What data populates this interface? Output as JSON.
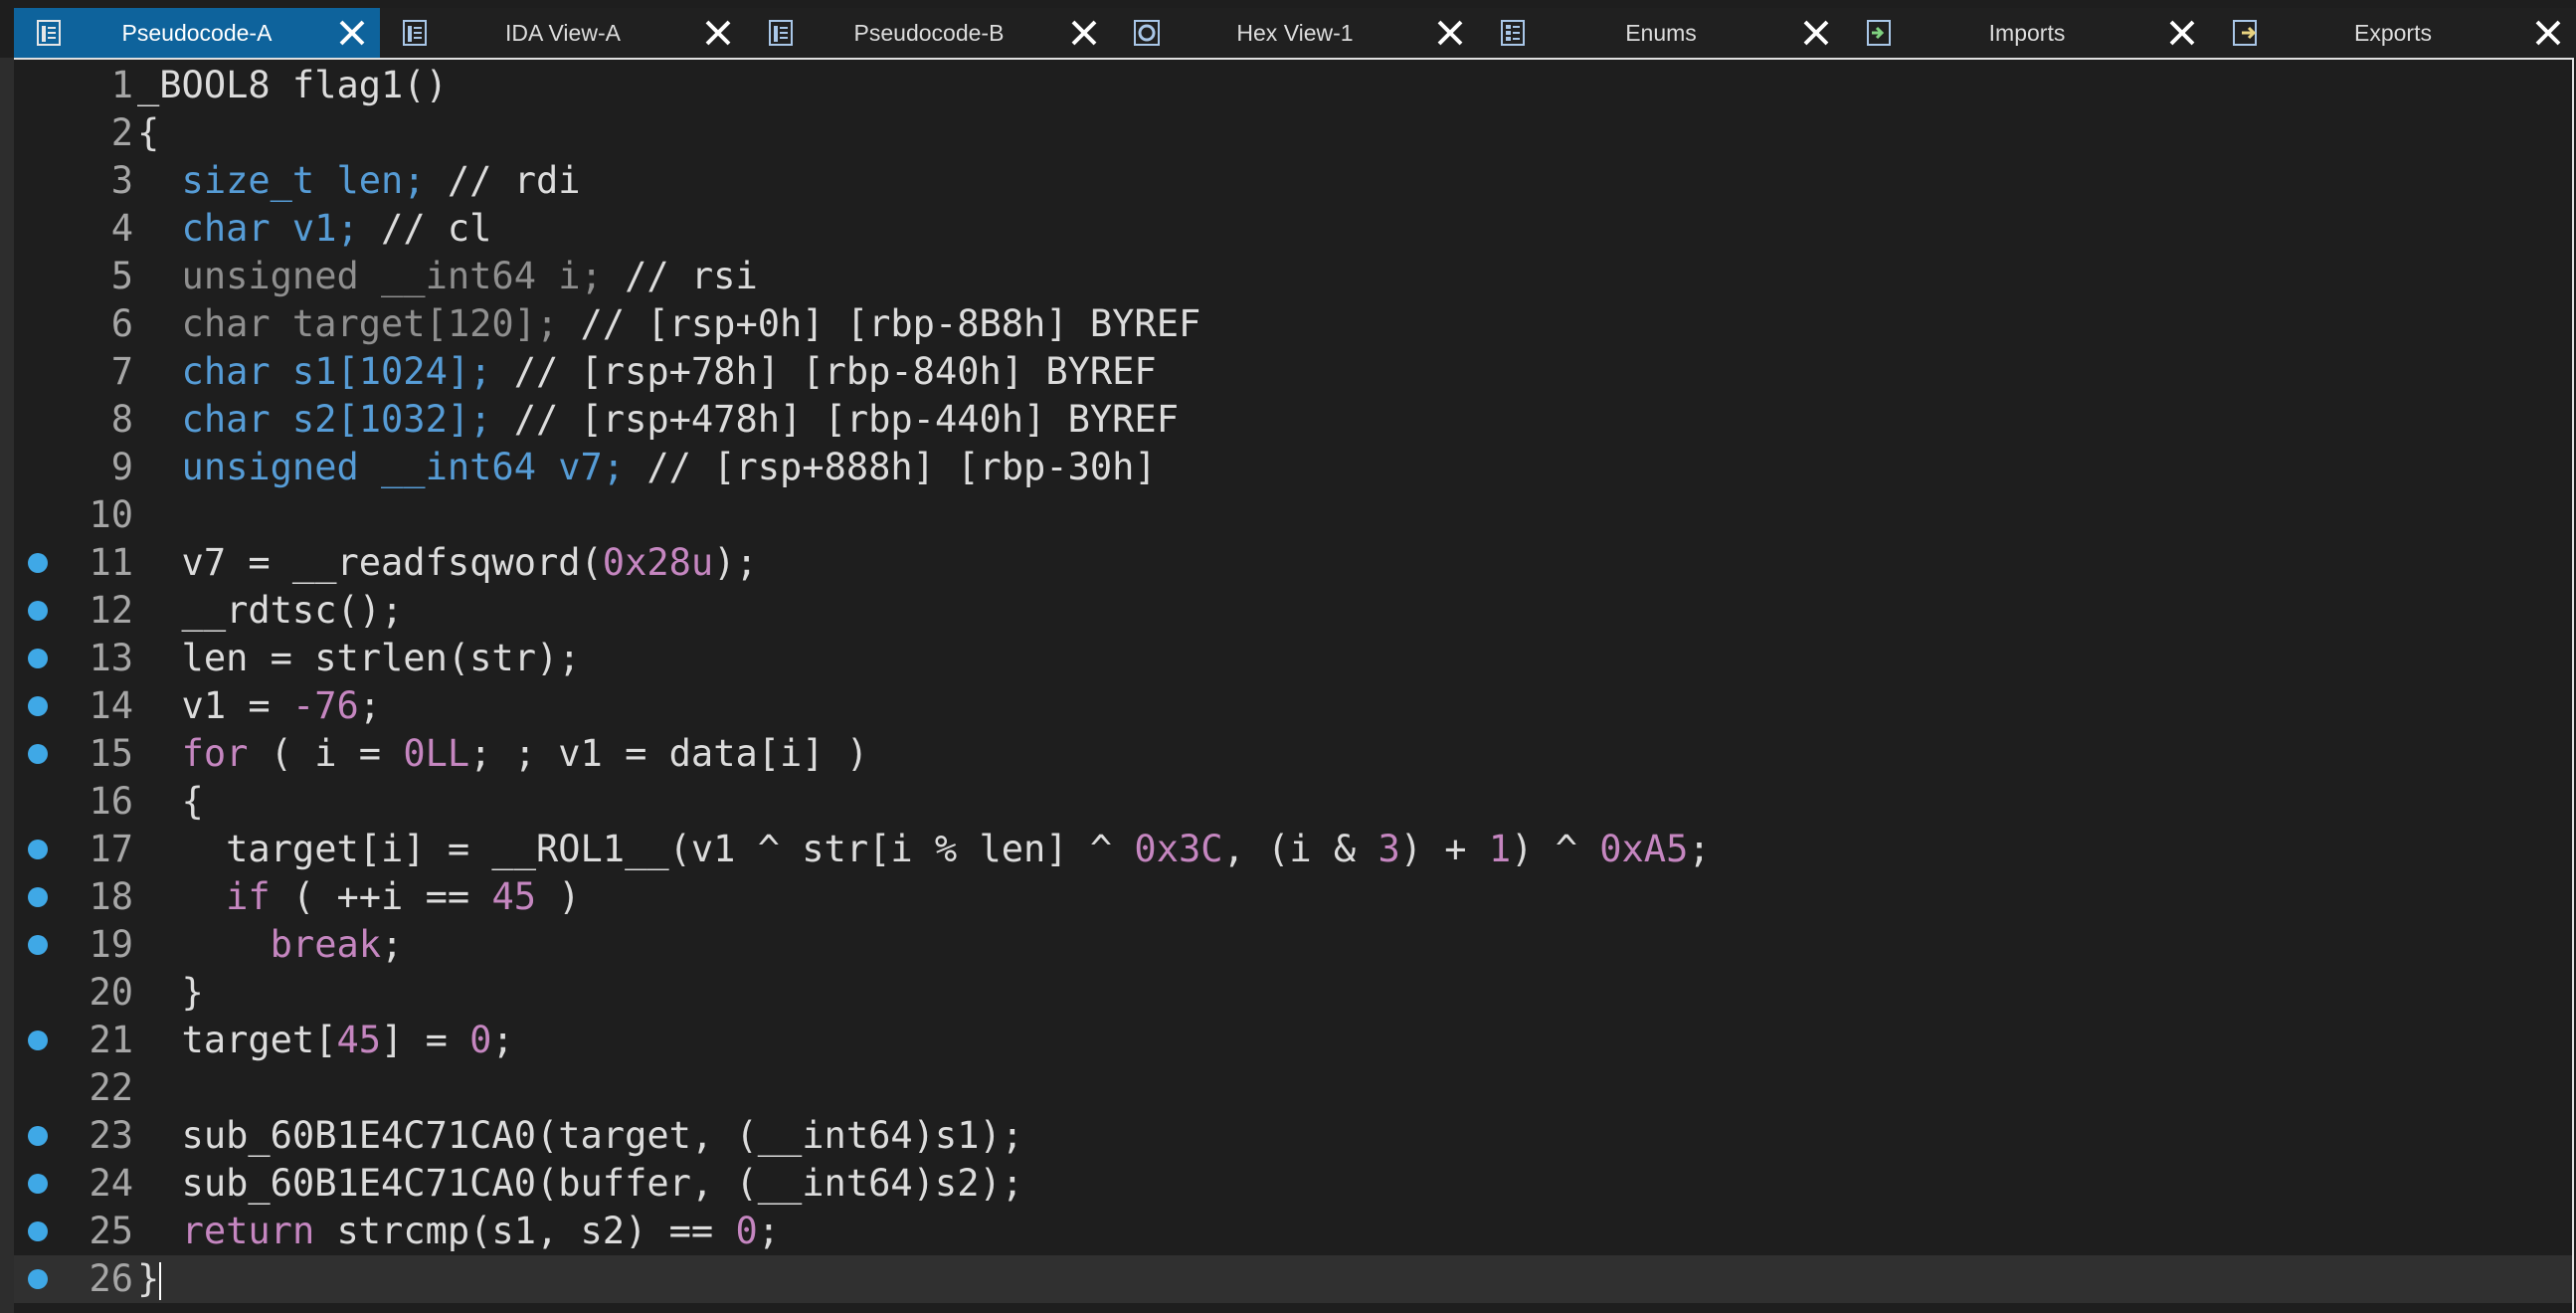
{
  "colors": {
    "active_tab": "#0e639c",
    "tabbar_bg": "#202020",
    "editor_bg": "#1e1e1e",
    "current_line": "#303030",
    "breakpoint_dot": "#3fa8e6",
    "keyword": "#569cd6",
    "number": "#b5cea8",
    "control": "#c586c0"
  },
  "tabs": [
    {
      "label": "Pseudocode-A",
      "icon": "pseudocode-icon",
      "active": true
    },
    {
      "label": "IDA View-A",
      "icon": "disassembly-view-icon",
      "active": false
    },
    {
      "label": "Pseudocode-B",
      "icon": "pseudocode-icon",
      "active": false
    },
    {
      "label": "Hex View-1",
      "icon": "hex-view-icon",
      "active": false
    },
    {
      "label": "Enums",
      "icon": "enums-icon",
      "active": false
    },
    {
      "label": "Imports",
      "icon": "imports-icon",
      "active": false
    },
    {
      "label": "Exports",
      "icon": "exports-icon",
      "active": false
    }
  ],
  "code": {
    "current_line": 26,
    "lines": [
      {
        "n": "1",
        "bp": false,
        "tokens": [
          {
            "t": "_BOOL8 flag1()",
            "c": ""
          }
        ]
      },
      {
        "n": "2",
        "bp": false,
        "tokens": [
          {
            "t": "{",
            "c": ""
          }
        ]
      },
      {
        "n": "3",
        "bp": false,
        "tokens": [
          {
            "t": "  size_t len; ",
            "c": "kw"
          },
          {
            "t": "// rdi",
            "c": "cm"
          }
        ]
      },
      {
        "n": "4",
        "bp": false,
        "tokens": [
          {
            "t": "  char v1; ",
            "c": "kw"
          },
          {
            "t": "// cl",
            "c": "cm"
          }
        ]
      },
      {
        "n": "5",
        "bp": false,
        "tokens": [
          {
            "t": "  unsigned __int64 i; ",
            "c": "ty"
          },
          {
            "t": "// rsi",
            "c": "cm"
          }
        ]
      },
      {
        "n": "6",
        "bp": false,
        "tokens": [
          {
            "t": "  char target[120]; ",
            "c": "ty"
          },
          {
            "t": "// [rsp+0h] [rbp-8B8h] BYREF",
            "c": "cm"
          }
        ]
      },
      {
        "n": "7",
        "bp": false,
        "tokens": [
          {
            "t": "  char s1[1024]; ",
            "c": "kw"
          },
          {
            "t": "// [rsp+78h] [rbp-840h] BYREF",
            "c": "cm"
          }
        ]
      },
      {
        "n": "8",
        "bp": false,
        "tokens": [
          {
            "t": "  char s2[1032]; ",
            "c": "kw"
          },
          {
            "t": "// [rsp+478h] [rbp-440h] BYREF",
            "c": "cm"
          }
        ]
      },
      {
        "n": "9",
        "bp": false,
        "tokens": [
          {
            "t": "  unsigned __int64 v7; ",
            "c": "kw"
          },
          {
            "t": "// [rsp+888h] [rbp-30h]",
            "c": "cm"
          }
        ]
      },
      {
        "n": "10",
        "bp": false,
        "tokens": []
      },
      {
        "n": "11",
        "bp": true,
        "tokens": [
          {
            "t": "  v7 = __readfsqword(",
            "c": ""
          },
          {
            "t": "0x28u",
            "c": "hex"
          },
          {
            "t": ");",
            "c": ""
          }
        ]
      },
      {
        "n": "12",
        "bp": true,
        "tokens": [
          {
            "t": "  __rdtsc();",
            "c": ""
          }
        ]
      },
      {
        "n": "13",
        "bp": true,
        "tokens": [
          {
            "t": "  len = strlen(str);",
            "c": ""
          }
        ]
      },
      {
        "n": "14",
        "bp": true,
        "tokens": [
          {
            "t": "  v1 = ",
            "c": ""
          },
          {
            "t": "-76",
            "c": "hex"
          },
          {
            "t": ";",
            "c": ""
          }
        ]
      },
      {
        "n": "15",
        "bp": true,
        "tokens": [
          {
            "t": "  ",
            "c": ""
          },
          {
            "t": "for",
            "c": "ctl"
          },
          {
            "t": " ( i = ",
            "c": ""
          },
          {
            "t": "0LL",
            "c": "hex"
          },
          {
            "t": "; ; v1 = data[i] )",
            "c": ""
          }
        ]
      },
      {
        "n": "16",
        "bp": false,
        "tokens": [
          {
            "t": "  {",
            "c": ""
          }
        ]
      },
      {
        "n": "17",
        "bp": true,
        "tokens": [
          {
            "t": "    target[i] = __ROL1__(v1 ^ str[i % len] ^ ",
            "c": ""
          },
          {
            "t": "0x3C",
            "c": "hex"
          },
          {
            "t": ", (i & ",
            "c": ""
          },
          {
            "t": "3",
            "c": "hex"
          },
          {
            "t": ") + ",
            "c": ""
          },
          {
            "t": "1",
            "c": "hex"
          },
          {
            "t": ") ^ ",
            "c": ""
          },
          {
            "t": "0xA5",
            "c": "hex"
          },
          {
            "t": ";",
            "c": ""
          }
        ]
      },
      {
        "n": "18",
        "bp": true,
        "tokens": [
          {
            "t": "    ",
            "c": ""
          },
          {
            "t": "if",
            "c": "ctl"
          },
          {
            "t": " ( ++i == ",
            "c": ""
          },
          {
            "t": "45",
            "c": "hex"
          },
          {
            "t": " )",
            "c": ""
          }
        ]
      },
      {
        "n": "19",
        "bp": true,
        "tokens": [
          {
            "t": "      ",
            "c": ""
          },
          {
            "t": "break",
            "c": "ctl"
          },
          {
            "t": ";",
            "c": ""
          }
        ]
      },
      {
        "n": "20",
        "bp": false,
        "tokens": [
          {
            "t": "  }",
            "c": ""
          }
        ]
      },
      {
        "n": "21",
        "bp": true,
        "tokens": [
          {
            "t": "  target[",
            "c": ""
          },
          {
            "t": "45",
            "c": "hex"
          },
          {
            "t": "] = ",
            "c": ""
          },
          {
            "t": "0",
            "c": "hex"
          },
          {
            "t": ";",
            "c": ""
          }
        ]
      },
      {
        "n": "22",
        "bp": false,
        "tokens": []
      },
      {
        "n": "23",
        "bp": true,
        "tokens": [
          {
            "t": "  sub_60B1E4C71CA0(target, (__int64)s1);",
            "c": ""
          }
        ]
      },
      {
        "n": "24",
        "bp": true,
        "tokens": [
          {
            "t": "  sub_60B1E4C71CA0(buffer, (__int64)s2);",
            "c": ""
          }
        ]
      },
      {
        "n": "25",
        "bp": true,
        "tokens": [
          {
            "t": "  ",
            "c": ""
          },
          {
            "t": "return",
            "c": "ctl"
          },
          {
            "t": " strcmp(s1, s2) == ",
            "c": ""
          },
          {
            "t": "0",
            "c": "hex"
          },
          {
            "t": ";",
            "c": ""
          }
        ]
      },
      {
        "n": "26",
        "bp": true,
        "tokens": [
          {
            "t": "}",
            "c": ""
          }
        ]
      }
    ]
  }
}
